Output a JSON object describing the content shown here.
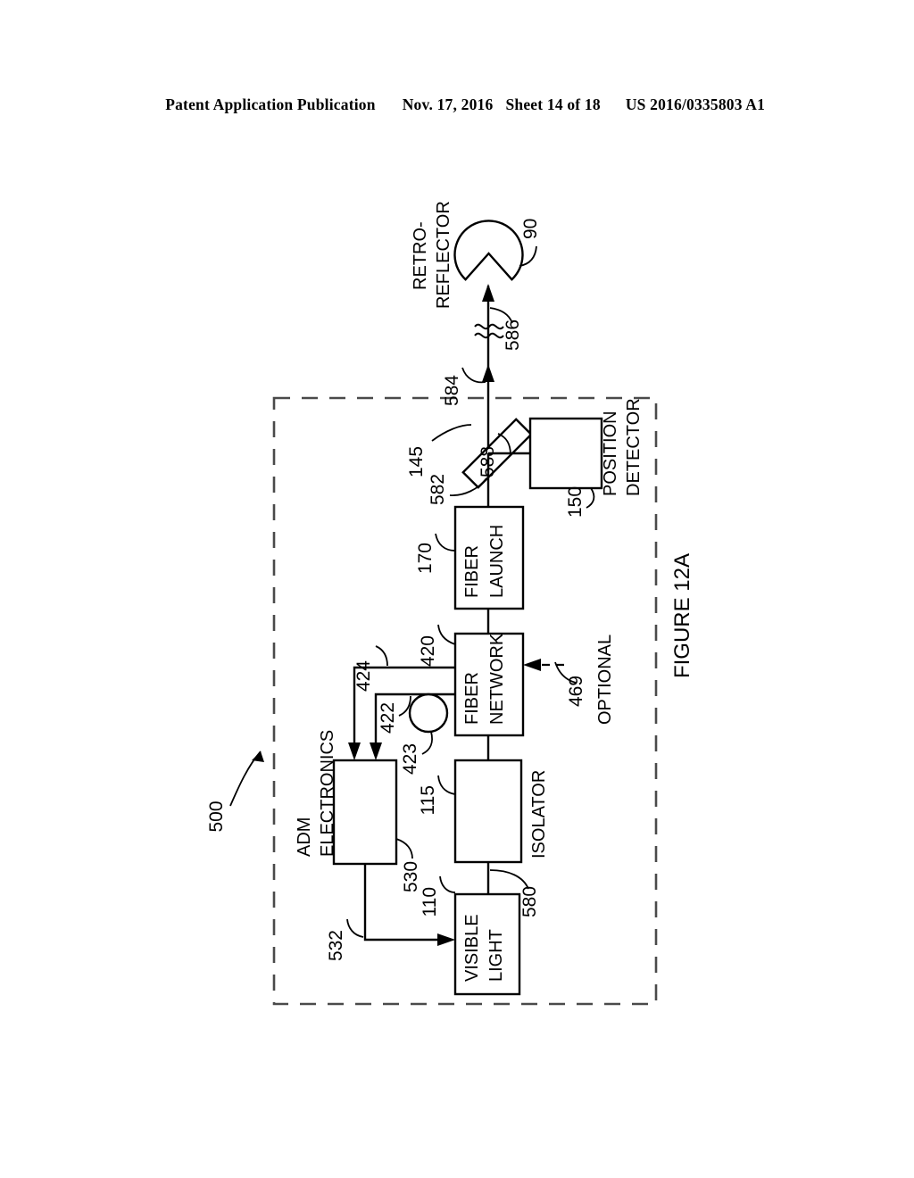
{
  "header": {
    "publication": "Patent Application Publication",
    "date": "Nov. 17, 2016",
    "sheet": "Sheet 14 of 18",
    "patent_number": "US 2016/0335803 A1"
  },
  "figure": {
    "caption": "FIGURE 12A",
    "assembly_ref": "500"
  },
  "blocks": [
    {
      "id": "retroreflector",
      "label_line1": "RETRO-",
      "label_line2": "REFLECTOR",
      "ref": "90"
    },
    {
      "id": "position-detector",
      "label_line1": "POSITION",
      "label_line2": "DETECTOR",
      "ref": "150"
    },
    {
      "id": "beam-splitter",
      "label_line1": "",
      "label_line2": "",
      "ref": "145"
    },
    {
      "id": "fiber-launch",
      "label_line1": "FIBER",
      "label_line2": "LAUNCH",
      "ref": "170"
    },
    {
      "id": "fiber-network",
      "label_line1": "FIBER",
      "label_line2": "NETWORK",
      "ref": "420"
    },
    {
      "id": "isolator",
      "label_line1": "ISOLATOR",
      "label_line2": "",
      "ref": "115"
    },
    {
      "id": "visible-light",
      "label_line1": "VISIBLE",
      "label_line2": "LIGHT",
      "ref": "110"
    },
    {
      "id": "adm-electronics",
      "label_line1": "ADM",
      "label_line2": "ELECTRONICS",
      "ref": "530"
    }
  ],
  "labels": {
    "retroreflector_line1": "RETRO-",
    "retroreflector_line2": "REFLECTOR",
    "position_detector_line1": "POSITION",
    "position_detector_line2": "DETECTOR",
    "fiber_launch_line1": "FIBER",
    "fiber_launch_line2": "LAUNCH",
    "fiber_network_line1": "FIBER",
    "fiber_network_line2": "NETWORK",
    "isolator": "ISOLATOR",
    "visible_light_line1": "VISIBLE",
    "visible_light_line2": "LIGHT",
    "adm_line1": "ADM",
    "adm_line2": "ELECTRONICS",
    "optional": "OPTIONAL"
  },
  "refs": {
    "r90": "90",
    "r586": "586",
    "r584": "584",
    "r588": "588",
    "r582": "582",
    "r145": "145",
    "r150": "150",
    "r170": "170",
    "r420": "420",
    "r424": "424",
    "r422": "422",
    "r423": "423",
    "r469": "469",
    "r115": "115",
    "r110": "110",
    "r530": "530",
    "r532": "532",
    "r580": "580",
    "r500": "500"
  },
  "colors": {
    "ink": "#000000",
    "dashed_boundary": "#4a4a4a",
    "paper": "#ffffff"
  }
}
